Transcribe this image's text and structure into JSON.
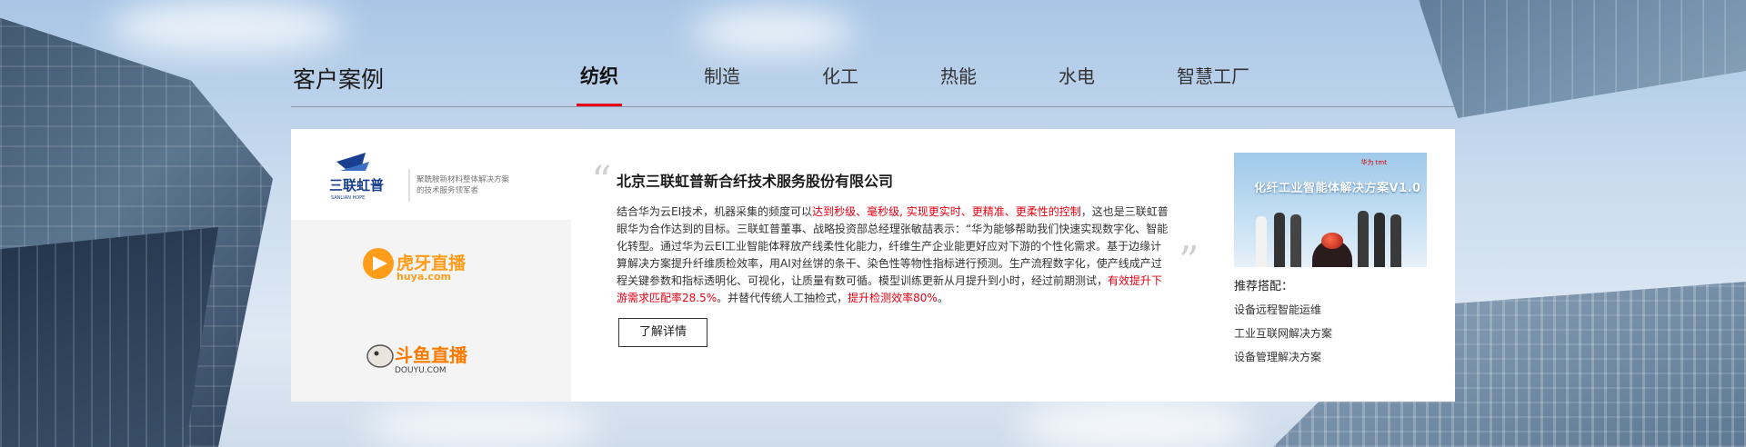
{
  "section": {
    "title": "客户案例"
  },
  "tabs": [
    {
      "label": "纺织",
      "active": true
    },
    {
      "label": "制造",
      "active": false
    },
    {
      "label": "化工",
      "active": false
    },
    {
      "label": "热能",
      "active": false
    },
    {
      "label": "水电",
      "active": false
    },
    {
      "label": "智慧工厂",
      "active": false
    }
  ],
  "logos": [
    {
      "name": "三联虹普",
      "sub": "SANLIAN HOPE",
      "slogan_1": "聚酰胺新材料整体解决方案",
      "slogan_2": "的技术服务领军者",
      "active": true
    },
    {
      "name": "虎牙直播",
      "sub": "huya.com",
      "active": false
    },
    {
      "name": "斗鱼直播",
      "sub": "DOUYU.COM",
      "active": false
    }
  ],
  "case": {
    "quote_open": "“",
    "quote_close": "”",
    "company": "北京三联虹普新合纤技术服务股份有限公司",
    "desc_1": "结合华为云EI技术，机器采集的频度可以",
    "desc_hl_1": "达到秒级、毫秒级, 实现更实时、更精准、更柔性的控制",
    "desc_2": "，这也是三联虹普眼华为合作达到的目标。三联虹普董事、战略投资部总经理张敏喆表示：“华为能够帮助我们快速实现数字化、智能化转型。通过华为云EI工业智能体释放产线柔性化能力，纤维生产企业能更好应对下游的个性化需求。基于边缘计算解决方案提升纤维质检效率，用AI对丝饼的条干、染色性等物性指标进行预测。生产流程数字化，使产线成产过程关键参数和指标透明化、可视化，让质量有数可循。模型训练更新从月提升到小时，经过前期测试，",
    "desc_hl_2": "有效提升下游需求匹配率28.5%",
    "desc_3": "。并替代传统人工抽检式，",
    "desc_hl_3": "提升检测效率80%",
    "desc_4": "。",
    "more_label": "了解详情"
  },
  "side": {
    "photo_title": "化纤工业智能体解决方案V1.0",
    "photo_brands": "华为 tmt",
    "rec_title": "推荐搭配：",
    "rec_items": [
      "设备远程智能运维",
      "工业互联网解决方案",
      "设备管理解决方案"
    ]
  },
  "colors": {
    "accent": "#e60012",
    "huya": "#ff9c1a",
    "douyu": "#ff7a00",
    "sanlian": "#1a3f8f"
  }
}
